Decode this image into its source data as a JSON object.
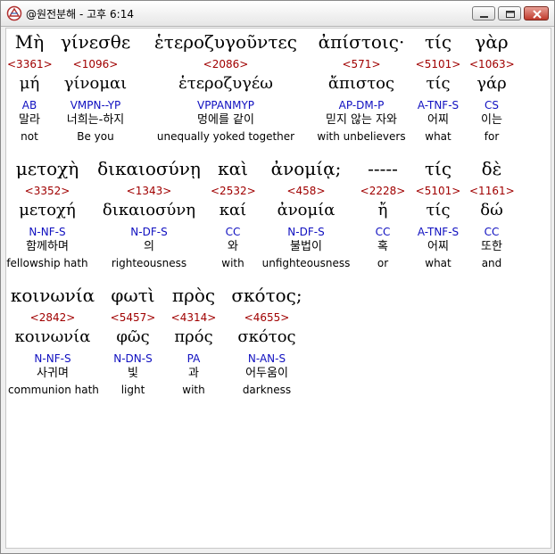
{
  "window": {
    "title": "@원전분해 - 고후 6:14"
  },
  "lines": [
    {
      "words": [
        {
          "greek": "Μὴ",
          "strong": "<3361>",
          "lemma": "μή",
          "parse": "AB",
          "korean": "말라",
          "english": "not"
        },
        {
          "greek": "γίνεσθε",
          "strong": "<1096>",
          "lemma": "γίνομαι",
          "parse": "VMPN--YP",
          "korean": "너희는-하지",
          "english": "Be you"
        },
        {
          "greek": "ἑτεροζυγοῦντες",
          "strong": "<2086>",
          "lemma": "ἑτεροζυγέω",
          "parse": "VPPANMYP",
          "korean": "멍에를 같이",
          "english": "unequally yoked together"
        },
        {
          "greek": "ἀπίστοις·",
          "strong": "<571>",
          "lemma": "ἄπιστος",
          "parse": "AP-DM-P",
          "korean": "믿지 않는 자와",
          "english": "with unbelievers"
        },
        {
          "greek": "τίς",
          "strong": "<5101>",
          "lemma": "τίς",
          "parse": "A-TNF-S",
          "korean": "어찌",
          "english": "what"
        },
        {
          "greek": "γὰρ",
          "strong": "<1063>",
          "lemma": "γάρ",
          "parse": "CS",
          "korean": "이는",
          "english": "for"
        }
      ]
    },
    {
      "words": [
        {
          "greek": "μετοχὴ",
          "strong": "<3352>",
          "lemma": "μετοχή",
          "parse": "N-NF-S",
          "korean": "함께하며",
          "english": "fellowship hath"
        },
        {
          "greek": "δικαιοσύνῃ",
          "strong": "<1343>",
          "lemma": "δικαιοσύνη",
          "parse": "N-DF-S",
          "korean": "의",
          "english": "righteousness"
        },
        {
          "greek": "καὶ",
          "strong": "<2532>",
          "lemma": "καί",
          "parse": "CC",
          "korean": "와",
          "english": "with"
        },
        {
          "greek": "ἀνομίᾳ;",
          "strong": "<458>",
          "lemma": "ἀνομία",
          "parse": "N-DF-S",
          "korean": "불법이",
          "english": "unfighteousness"
        },
        {
          "greek": "-----",
          "strong": "<2228>",
          "lemma": "ἤ",
          "parse": "CC",
          "korean": "혹",
          "english": "or"
        },
        {
          "greek": "τίς",
          "strong": "<5101>",
          "lemma": "τίς",
          "parse": "A-TNF-S",
          "korean": "어찌",
          "english": "what"
        },
        {
          "greek": "δὲ",
          "strong": "<1161>",
          "lemma": "δώ",
          "parse": "CC",
          "korean": "또한",
          "english": "and"
        }
      ]
    },
    {
      "words": [
        {
          "greek": "κοινωνία",
          "strong": "<2842>",
          "lemma": "κοινωνία",
          "parse": "N-NF-S",
          "korean": "사귀며",
          "english": "communion hath"
        },
        {
          "greek": "φωτὶ",
          "strong": "<5457>",
          "lemma": "φῶς",
          "parse": "N-DN-S",
          "korean": "빛",
          "english": "light"
        },
        {
          "greek": "πρὸς",
          "strong": "<4314>",
          "lemma": "πρός",
          "parse": "PA",
          "korean": "과",
          "english": "with"
        },
        {
          "greek": "σκότος;",
          "strong": "<4655>",
          "lemma": "σκότος",
          "parse": "N-AN-S",
          "korean": "어두움이",
          "english": "darkness"
        }
      ]
    }
  ]
}
